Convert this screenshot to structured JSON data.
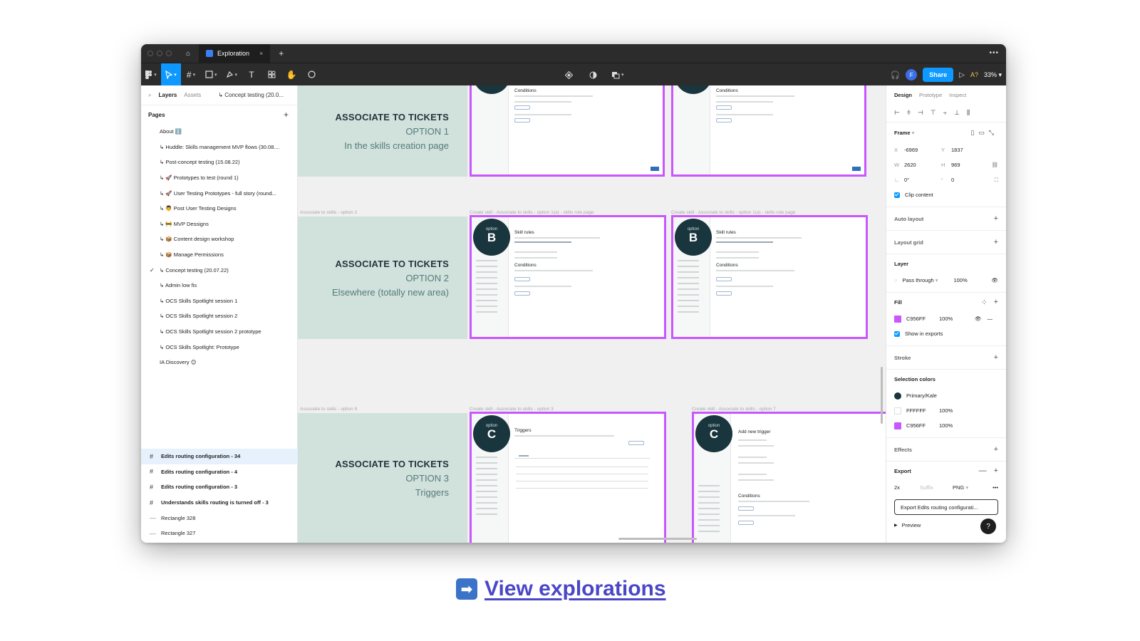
{
  "titlebar": {
    "tab_label": "Exploration",
    "close": "×",
    "new_tab": "+",
    "more": "•••"
  },
  "toolbar": {
    "share": "Share",
    "zoom": "33%",
    "collab": "A?",
    "avatar": "F"
  },
  "left_panel": {
    "tabs": {
      "layers": "Layers",
      "assets": "Assets",
      "crumb": "↳ Concept testing (20.0..."
    },
    "pages_title": "Pages",
    "pages": [
      "About ℹ️",
      "↳ Huddle: Skills management MVP flows (30.08....",
      "↳ Post-concept testing (15.08.22)",
      "↳ 🚀 Prototypes to test (round 1)",
      "↳ 🚀 User Testing Prototypes -  full story (round...",
      "↳ 👨 Post User Testing Designs",
      "↳ 🚧 MVP Dessigns",
      "↳ 📦 Content design workshop",
      "↳ 📦 Manage Permissions",
      "↳ Concept testing (20.07.22)",
      "↳ Admin low fis",
      "↳ OCS Skills Spotlight session 1",
      "↳ OCS Skills Spotlight session 2",
      "↳ OCS Skills Spotlight session 2 prototype",
      "↳ OCS Skills Spotlight: Prototype",
      "IA Discovery 😊"
    ],
    "current_page_check": "✓",
    "layers": [
      {
        "label": "Edits routing configuration - 34",
        "selected": true
      },
      {
        "label": "Edits routing configuration - 4"
      },
      {
        "label": "Edits routing configuration - 3"
      },
      {
        "label": "Understands skills routing is turned off - 3"
      },
      {
        "label": "Rectangle 328"
      },
      {
        "label": "Rectangle 327"
      }
    ]
  },
  "canvas": {
    "cards": [
      {
        "line1": "ASSOCIATE TO TICKETS",
        "line2": "OPTION 1",
        "line3": "In the skills creation page"
      },
      {
        "line1": "ASSOCIATE TO TICKETS",
        "line2": "OPTION 2",
        "line3": "Elsewhere (totally new area)"
      },
      {
        "line1": "ASSOCIATE TO TICKETS",
        "line2": "OPTION 3",
        "line3": "Triggers"
      }
    ],
    "labels": {
      "r2_card": "Associate to skills - option 2",
      "r2_a": "Create skill - Associate to skills - option 1(a) - skills rule page",
      "r2_b": "Create skill - Associate to skills - option 1(a) - skills rule page",
      "r3_card": "Associate to skills - option 8",
      "r3_a": "Create skill - Associate to skills - option 3",
      "r3_b": "Create skill - Associate to skills - option 7"
    },
    "badges": {
      "option": "option",
      "b": "B",
      "c": "C"
    },
    "mock_titles": {
      "conditions": "Conditions",
      "skill_rules": "Skill rules",
      "triggers": "Triggers",
      "add_trigger": "Add new trigger"
    }
  },
  "right_panel": {
    "tabs": {
      "design": "Design",
      "prototype": "Prototype",
      "inspect": "Inspect"
    },
    "frame": {
      "title": "Frame",
      "x_label": "X",
      "x": "-6969",
      "y_label": "Y",
      "y": "1837",
      "w_label": "W",
      "w": "2620",
      "h_label": "H",
      "h": "969",
      "rot": "0°",
      "radius": "0",
      "clip": "Clip content"
    },
    "auto_layout": "Auto layout",
    "layout_grid": "Layout grid",
    "layer": {
      "title": "Layer",
      "mode": "Pass through",
      "opacity": "100%"
    },
    "fill": {
      "title": "Fill",
      "hex": "C956FF",
      "opacity": "100%",
      "show_exports": "Show in exports"
    },
    "stroke": "Stroke",
    "selection_colors": {
      "title": "Selection colors",
      "items": [
        {
          "name": "Primary/Kale",
          "color": "#19353d"
        },
        {
          "name": "FFFFFF",
          "opacity": "100%",
          "color": "#ffffff"
        },
        {
          "name": "C956FF",
          "opacity": "100%",
          "color": "#c956ff"
        }
      ]
    },
    "effects": "Effects",
    "export": {
      "title": "Export",
      "scale": "2x",
      "suffix": "Suffix",
      "format": "PNG",
      "button": "Export Edits routing configurati...",
      "preview": "Preview"
    }
  },
  "cta": {
    "icon": "➡",
    "label": "View explorations"
  },
  "colors": {
    "accent": "#0d99ff",
    "frame_stroke": "#c956ff",
    "card_bg": "#d1e2dd"
  }
}
